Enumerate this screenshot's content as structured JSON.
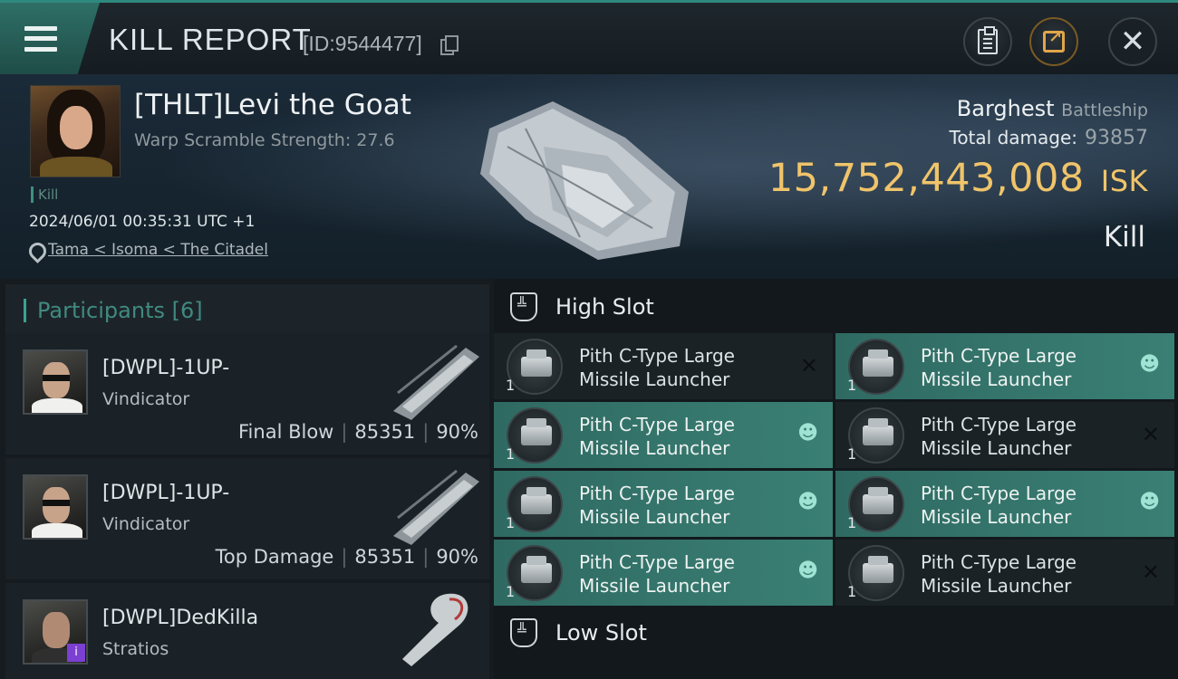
{
  "header": {
    "title": "KILL REPORT",
    "report_id": "[ID:9544477]"
  },
  "victim": {
    "name": "[THLT]Levi the Goat",
    "warp_scramble": "Warp Scramble Strength: 27.6",
    "kill_tag": "Kill",
    "datetime": "2024/06/01 00:35:31 UTC +1",
    "location": "Tama < Isoma < The Citadel",
    "ship_name": "Barghest",
    "ship_class": "Battleship",
    "total_damage_label": "Total damage:",
    "total_damage": "93857",
    "isk_value": "15,752,443,008",
    "isk_unit": "ISK",
    "result": "Kill"
  },
  "participants": {
    "header": "Participants [6]",
    "rows": [
      {
        "name": "[DWPL]-1UP-",
        "ship": "Vindicator",
        "role": "Final Blow",
        "damage": "85351",
        "percent": "90%"
      },
      {
        "name": "[DWPL]-1UP-",
        "ship": "Vindicator",
        "role": "Top Damage",
        "damage": "85351",
        "percent": "90%"
      },
      {
        "name": "[DWPL]DedKilla",
        "ship": "Stratios",
        "badge": "i"
      }
    ]
  },
  "slots": {
    "high_label": "High Slot",
    "low_label": "Low Slot",
    "modules": [
      {
        "line1": "Pith C-Type Large",
        "line2": "Missile Launcher",
        "qty": "1",
        "state": "destroyed"
      },
      {
        "line1": "Pith C-Type Large",
        "line2": "Missile Launcher",
        "qty": "1",
        "state": "dropped"
      },
      {
        "line1": "Pith C-Type Large",
        "line2": "Missile Launcher",
        "qty": "1",
        "state": "dropped"
      },
      {
        "line1": "Pith C-Type Large",
        "line2": "Missile Launcher",
        "qty": "1",
        "state": "destroyed"
      },
      {
        "line1": "Pith C-Type Large",
        "line2": "Missile Launcher",
        "qty": "1",
        "state": "dropped"
      },
      {
        "line1": "Pith C-Type Large",
        "line2": "Missile Launcher",
        "qty": "1",
        "state": "dropped"
      },
      {
        "line1": "Pith C-Type Large",
        "line2": "Missile Launcher",
        "qty": "1",
        "state": "dropped"
      },
      {
        "line1": "Pith C-Type Large",
        "line2": "Missile Launcher",
        "qty": "1",
        "state": "destroyed"
      }
    ]
  },
  "icons": {
    "menu": "hamburger-icon",
    "copy": "copy-icon",
    "clipboard": "clipboard-icon",
    "share": "share-icon",
    "close": "close-icon",
    "location": "map-pin-icon",
    "slot": "shield-icon",
    "dropped": "person-icon",
    "destroyed": "x-icon"
  },
  "colors": {
    "accent": "#2f8a7e",
    "isk": "#f0c46a",
    "dropped_bg": "#3a7f74"
  }
}
